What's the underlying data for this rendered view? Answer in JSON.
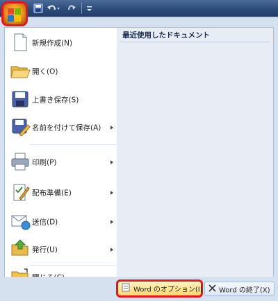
{
  "quick_access": {
    "icons": [
      "save-icon",
      "undo-icon",
      "redo-icon",
      "customize-toolbar-icon"
    ]
  },
  "menu": {
    "items": [
      {
        "label": "新規作成(N)",
        "icon": "new-document-icon",
        "submenu": false
      },
      {
        "label": "開く(O)",
        "icon": "open-folder-icon",
        "submenu": false
      },
      {
        "label": "上書き保存(S)",
        "icon": "save-icon",
        "submenu": false
      },
      {
        "label": "名前を付けて保存(A)",
        "icon": "save-as-icon",
        "submenu": true
      },
      {
        "label": "印刷(P)",
        "icon": "print-icon",
        "submenu": true
      },
      {
        "label": "配布準備(E)",
        "icon": "prepare-icon",
        "submenu": true
      },
      {
        "label": "送信(D)",
        "icon": "send-icon",
        "submenu": true
      },
      {
        "label": "発行(U)",
        "icon": "publish-icon",
        "submenu": true
      },
      {
        "label": "閉じる(C)",
        "icon": "close-folder-icon",
        "submenu": false
      }
    ]
  },
  "recent": {
    "title": "最近使用したドキュメント"
  },
  "footer": {
    "options_label": "Word のオプション(I)",
    "exit_label": "Word の終了(X)"
  },
  "colors": {
    "highlight_border": "#e8141c",
    "titlebar": "#2b4a78"
  }
}
